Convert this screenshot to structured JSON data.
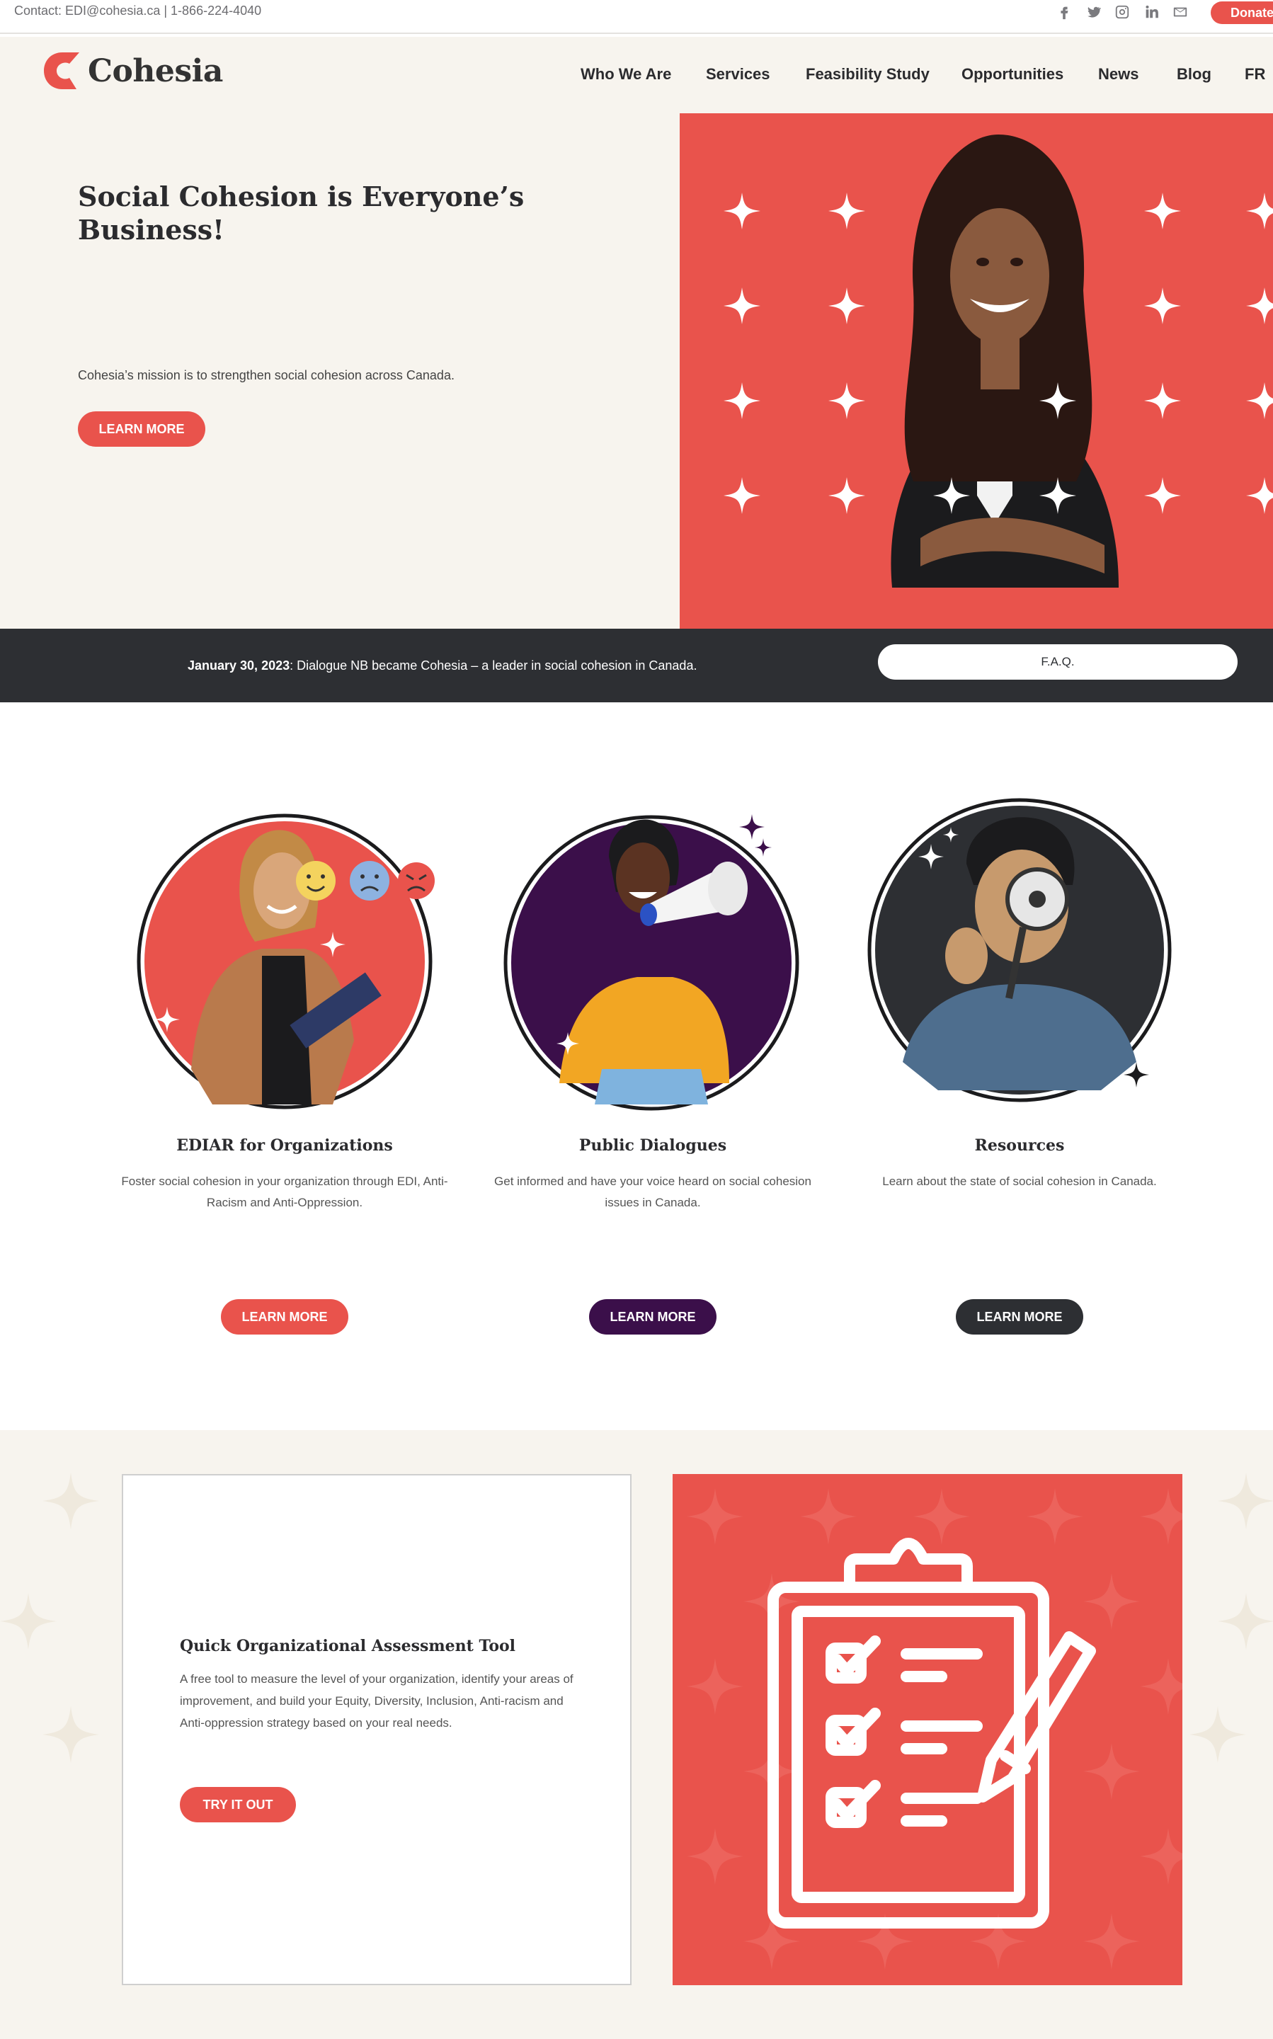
{
  "topbar": {
    "contact": "Contact: EDI@cohesia.ca | 1-866-224-4040",
    "social_icons": [
      "facebook-icon",
      "twitter-icon",
      "instagram-icon",
      "linkedin-icon",
      "mail-icon"
    ],
    "donate_label": "Donate"
  },
  "header": {
    "logo_text": "Cohesia",
    "nav": [
      "Who We Are",
      "Services",
      "Feasibility Study",
      "Opportunities",
      "News",
      "Blog",
      "FR"
    ]
  },
  "hero": {
    "title": "Social Cohesion is Everyone’s Business!",
    "subtitle": "Cohesia’s mission is to strengthen social cohesion across Canada.",
    "button": "LEARN MORE"
  },
  "strip": {
    "date": "January 30, 2023",
    "text": ": Dialogue NB became Cohesia – a leader in social cohesion in Canada.",
    "faq": "F.A.Q."
  },
  "cards": [
    {
      "title": "EDIAR for Organizations",
      "text": "Foster social cohesion in your organization through EDI, Anti-Racism and Anti-Oppression.",
      "button": "LEARN MORE"
    },
    {
      "title": "Public Dialogues",
      "text": "Get informed and have your voice heard on social cohesion issues in Canada.",
      "button": "LEARN MORE"
    },
    {
      "title": "Resources",
      "text": "Learn about the state of social cohesion in Canada.",
      "button": "LEARN MORE"
    }
  ],
  "assessment": {
    "title": "Quick Organizational Assessment Tool",
    "text": "A free tool to measure the level of your organization, identify your areas of improvement, and build your Equity, Diversity, Inclusion, Anti-racism and Anti-oppression strategy based on your real needs.",
    "button": "TRY IT OUT"
  },
  "colors": {
    "accent_red": "#e9534c",
    "purple": "#3b0f4a",
    "dark": "#2d2f33",
    "cream": "#f7f4ee"
  }
}
